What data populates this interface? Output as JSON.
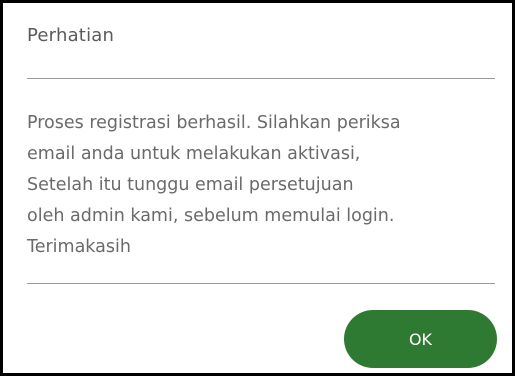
{
  "dialog": {
    "title": "Perhatian",
    "message_lines": [
      "Proses registrasi berhasil. Silahkan periksa",
      "email anda untuk melakukan aktivasi,",
      "Setelah itu tunggu email persetujuan",
      "oleh admin kami, sebelum memulai login.",
      "Terimakasih"
    ],
    "ok_label": "OK"
  },
  "colors": {
    "button": "#2f7a33",
    "button_text": "#ffffff",
    "title_text": "#5a5a5a",
    "body_text": "#6a6a6a",
    "divider": "#9a9a9a"
  }
}
